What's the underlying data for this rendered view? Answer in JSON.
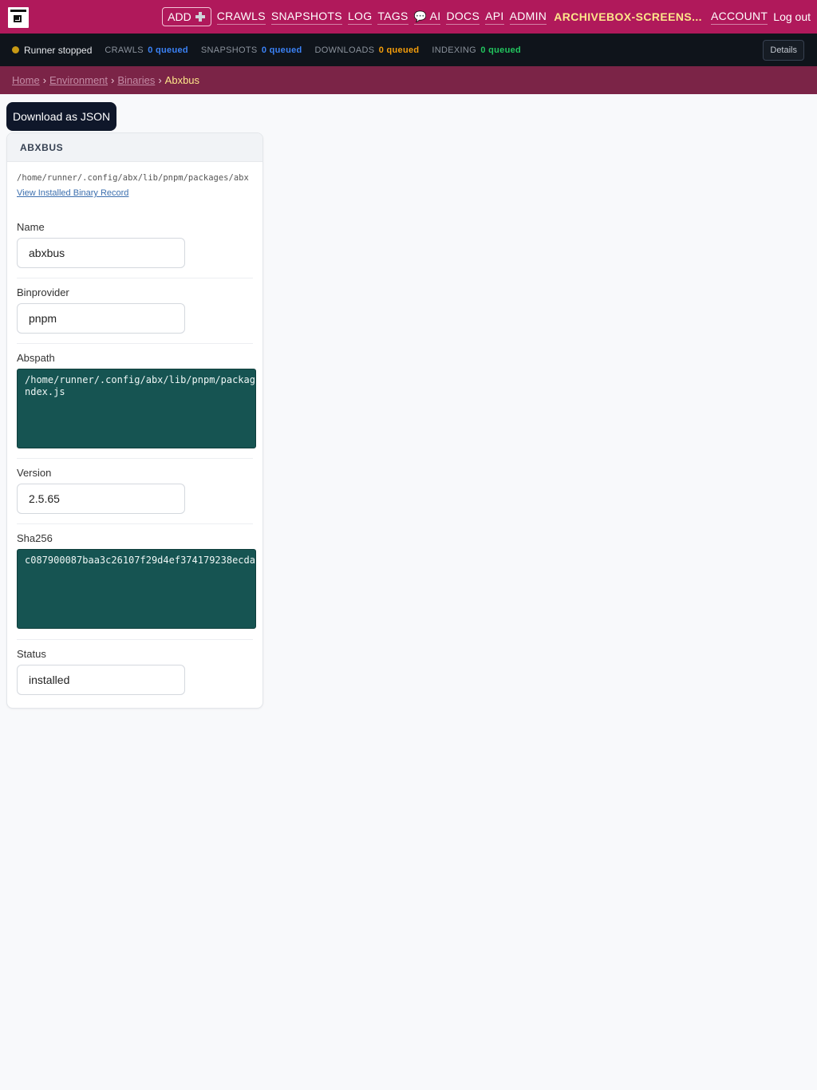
{
  "nav": {
    "add_label": "ADD",
    "links": [
      "CRAWLS",
      "SNAPSHOTS",
      "LOG",
      "TAGS"
    ],
    "ai_label": "AI",
    "links2": [
      "DOCS",
      "API",
      "ADMIN"
    ],
    "brand": "ARCHIVEBOX-SCREENS...",
    "account": "ACCOUNT",
    "logout": "Log out"
  },
  "status": {
    "runner": "Runner stopped",
    "crawls_label": "CRAWLS",
    "crawls_q": "0 queued",
    "snapshots_label": "SNAPSHOTS",
    "snapshots_q": "0 queued",
    "downloads_label": "DOWNLOADS",
    "downloads_q": "0 queued",
    "indexing_label": "INDEXING",
    "indexing_q": "0 queued",
    "details": "Details",
    "colors": {
      "runner_dot": "#c89914",
      "crawls": "#3b82f6",
      "downloads": "#f59e0b",
      "indexing": "#22c55e"
    }
  },
  "breadcrumb": {
    "home": "Home",
    "environment": "Environment",
    "binaries": "Binaries",
    "current": "Abxbus"
  },
  "download_label": "Download as JSON",
  "card": {
    "title": "ABXBUS",
    "path": "/home/runner/.config/abx/lib/pnpm/packages/abx",
    "record_link": "View Installed Binary Record",
    "fields": {
      "name_label": "Name",
      "name_value": "abxbus",
      "binprovider_label": "Binprovider",
      "binprovider_value": "pnpm",
      "abspath_label": "Abspath",
      "abspath_value": "/home/runner/.config/abx/lib/pnpm/packag\nndex.js",
      "version_label": "Version",
      "version_value": "2.5.65",
      "sha_label": "Sha256",
      "sha_value": "c087900087baa3c26107f29d4ef374179238ecda",
      "status_label": "Status",
      "status_value": "installed"
    }
  },
  "theme": {
    "nav_bg": "#b0195b",
    "status_bg": "#0f141b",
    "crumb_bg": "#7b2447",
    "textarea_bg": "#165452"
  }
}
